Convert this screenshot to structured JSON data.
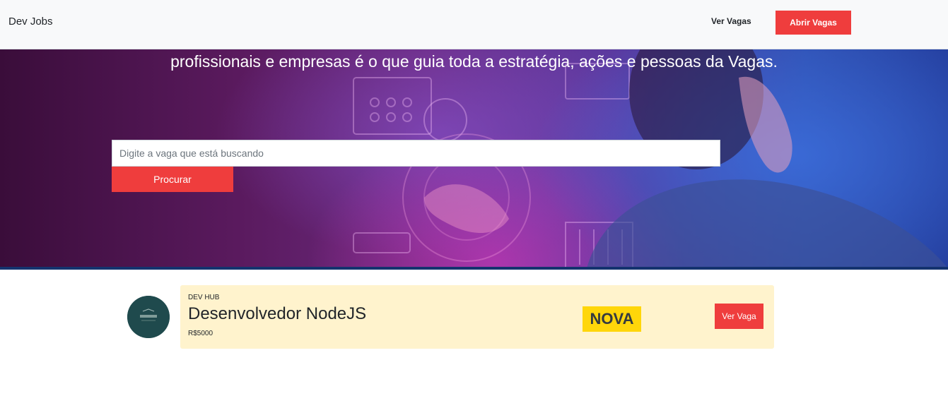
{
  "navbar": {
    "brand": "Dev Jobs",
    "links": {
      "view_jobs": "Ver Vagas",
      "open_jobs": "Abrir Vagas"
    },
    "colors": {
      "background": "#f8f9fa",
      "accent": "#ef3d3d"
    }
  },
  "hero": {
    "headline": "profissionais e empresas é o que guia toda a estratégia, ações e pessoas da Vagas.",
    "search": {
      "placeholder": "Digite a vaga que está buscando",
      "value": ""
    },
    "search_button": "Procurar"
  },
  "jobs": [
    {
      "company": "DEV HUB",
      "title": "Desenvolvedor NodeJS",
      "salary": "R$5000",
      "badge": "NOVA",
      "action": "Ver Vaga",
      "logo_icon": "company-logo-icon",
      "colors": {
        "card": "#fff3cd",
        "badge": "#ffd60a",
        "button": "#ef3d3d"
      }
    }
  ]
}
